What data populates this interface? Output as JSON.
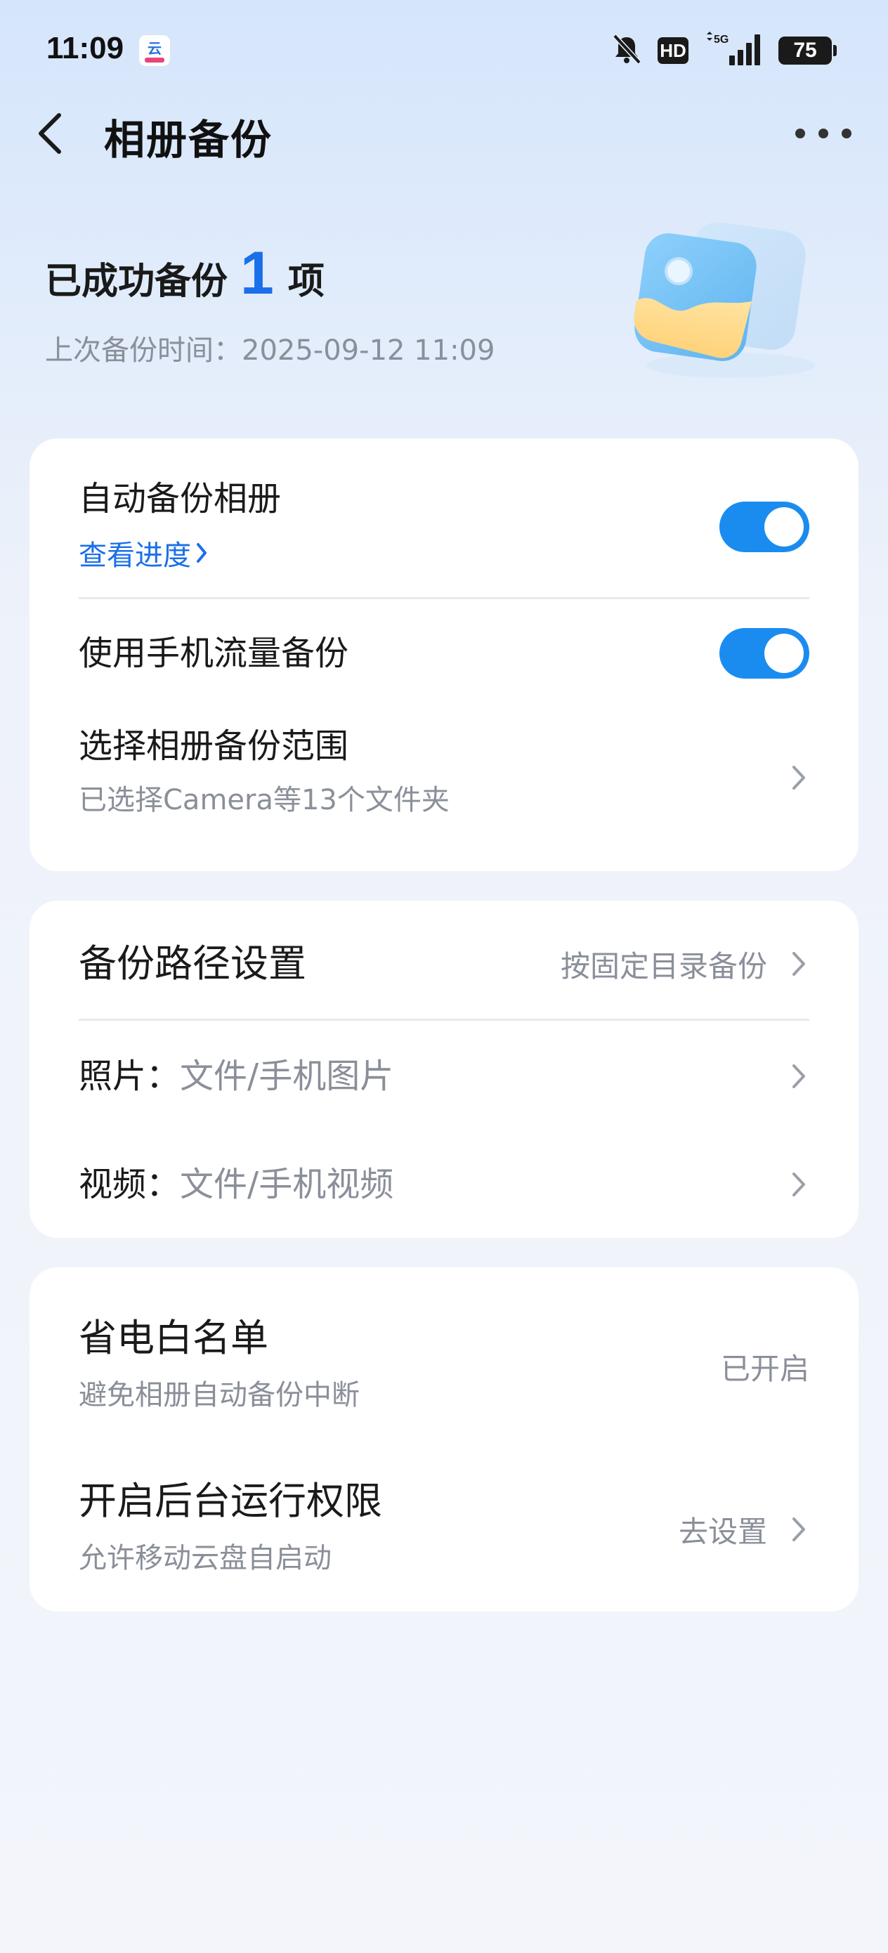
{
  "status_bar": {
    "time": "11:09",
    "app_icon": "cloud-drive-app-icon",
    "icons": [
      "mute-bell-icon",
      "hd-icon",
      "signal-5g-icon",
      "battery-icon"
    ],
    "hd_label": "HD",
    "network": "5G",
    "battery_level": "75"
  },
  "header": {
    "title": "相册备份",
    "back_icon": "chevron-left-icon",
    "more_icon": "more-dots-icon"
  },
  "summary": {
    "prefix": "已成功备份",
    "count": "1",
    "suffix": "项",
    "last_backup_label": "上次备份时间：",
    "last_backup_time": "2025-09-12 11:09"
  },
  "card1": {
    "auto_backup": {
      "title": "自动备份相册",
      "link": "查看进度",
      "enabled": true
    },
    "mobile_data": {
      "title": "使用手机流量备份",
      "enabled": true
    },
    "scope": {
      "title": "选择相册备份范围",
      "subtitle": "已选择Camera等13个文件夹"
    }
  },
  "card2": {
    "path_setting": {
      "title": "备份路径设置",
      "value": "按固定目录备份"
    },
    "photos": {
      "label": "照片：",
      "value": "文件/手机图片"
    },
    "videos": {
      "label": "视频：",
      "value": "文件/手机视频"
    }
  },
  "card3": {
    "power_whitelist": {
      "title": "省电白名单",
      "subtitle": "避免相册自动备份中断",
      "value": "已开启"
    },
    "background_permission": {
      "title": "开启后台运行权限",
      "subtitle": "允许移动云盘自启动",
      "value": "去设置"
    }
  },
  "colors": {
    "accent": "#1b6fe8",
    "toggle_on": "#1a8cf0",
    "secondary_text": "#8a8f99"
  }
}
